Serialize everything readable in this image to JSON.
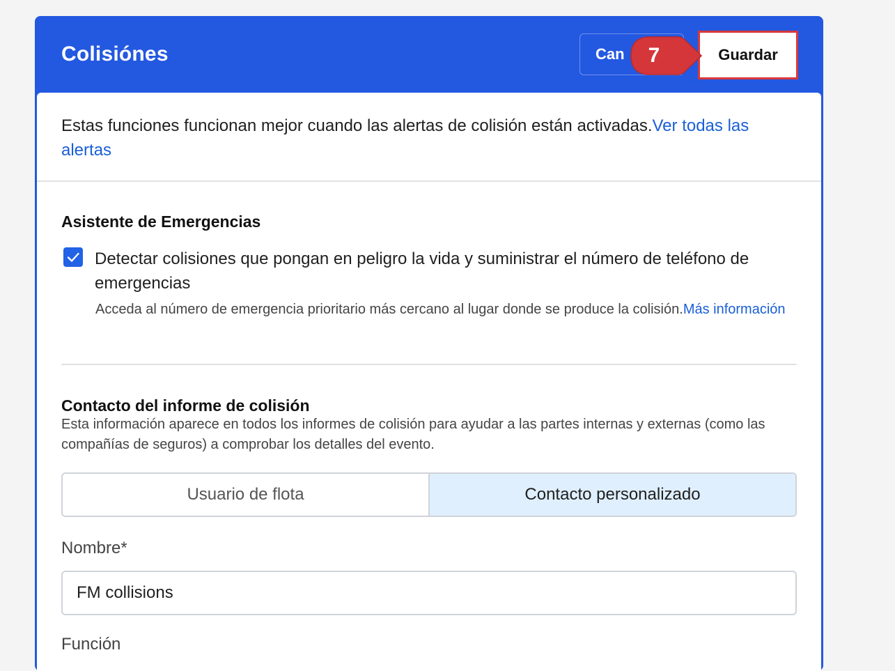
{
  "dialog": {
    "title": "Colisiónes",
    "cancel_label": "Can",
    "save_label": "Guardar",
    "step_number": "7"
  },
  "notice": {
    "text": "Estas funciones funcionan mejor cuando las alertas de colisión están activadas.",
    "link": "Ver todas las alertas"
  },
  "emergency": {
    "title": "Asistente de Emergencias",
    "checkbox_checked": true,
    "checkbox_label": "Detectar colisiones que pongan en peligro la vida y suministrar el número de teléfono de emergencias",
    "help_text": "Acceda al número de emergencia prioritario más cercano al lugar donde se produce la colisión.",
    "help_link": "Más información"
  },
  "contact": {
    "title": "Contacto del informe de colisión",
    "description": "Esta información aparece en todos los informes de colisión para ayudar a las partes internas y externas (como las compañías de seguros) a comprobar los detalles del evento.",
    "tabs": [
      {
        "label": "Usuario de flota",
        "active": false
      },
      {
        "label": "Contacto personalizado",
        "active": true
      }
    ],
    "name_label": "Nombre*",
    "name_value": "FM collisions",
    "role_label": "Función"
  },
  "colors": {
    "header_blue": "#2358e0",
    "link_blue": "#1a5fd6",
    "highlight_red": "#d9383a",
    "active_tab_bg": "#dfeffe"
  }
}
